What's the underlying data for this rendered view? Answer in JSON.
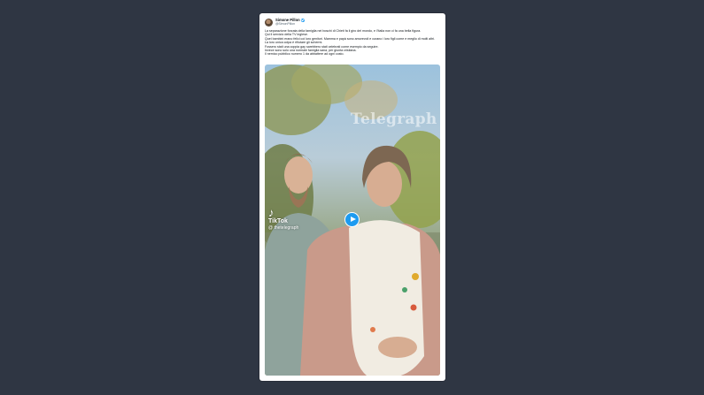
{
  "tweet": {
    "author_name": "Simone Pillon",
    "author_handle": "@SimonPillon",
    "lines": [
      "La separazione forzata della famiglia nei boschi di Chieti fa il giro del mondo, e l'Italia non ci fa una bella figura.",
      "Qui il servizio della TV inglese.",
      "Quei bambini erano felici coi loro genitori. Mamma e papà sono amorevoli e curano i loro figli come e meglio di molti altri.",
      "La loro unica colpa è rifiutare gli schermi.",
      "Fossero stati una coppia gay sarebbero stati celebrati come esempio da seguire.",
      "Invece sono solo una normale famiglia sana, per giunta cristiana.",
      "Il nemico pubblico numero 1 da abbattere ad ogni costo."
    ]
  },
  "video": {
    "watermark": "Telegraph",
    "tiktok_label": "TikTok",
    "tiktok_handle": "@ thetelegraph"
  },
  "colors": {
    "background": "#2f3643",
    "card": "#ffffff",
    "play_button": "#1d9bf0",
    "verified_badge": "#1d9bf0"
  },
  "icons": [
    "verified-badge-icon",
    "play-icon",
    "tiktok-icon"
  ]
}
